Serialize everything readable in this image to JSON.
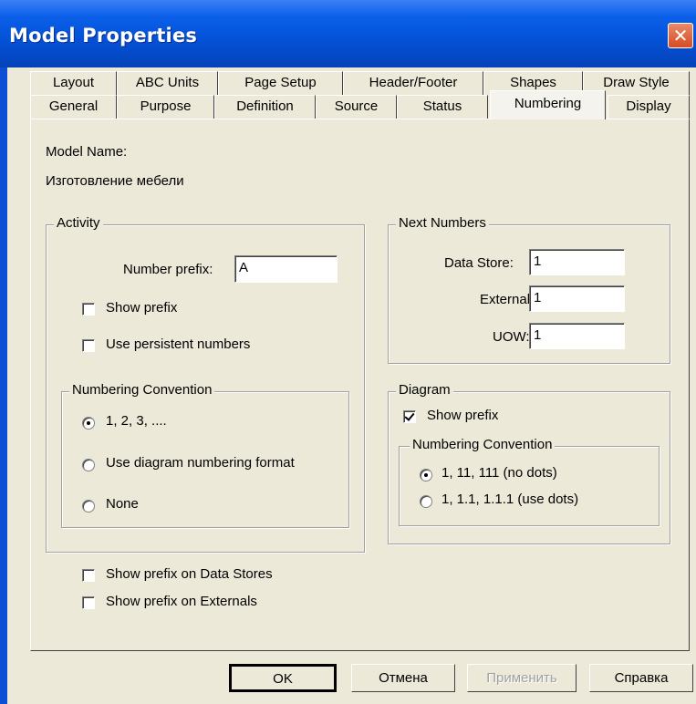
{
  "window": {
    "title": "Model Properties",
    "close_glyph": "✕"
  },
  "tabs": {
    "row1": [
      "Layout",
      "ABC Units",
      "Page Setup",
      "Header/Footer",
      "Shapes",
      "Draw Style"
    ],
    "row2": [
      "General",
      "Purpose",
      "Definition",
      "Source",
      "Status",
      "Numbering",
      "Display"
    ],
    "active": "Numbering"
  },
  "model": {
    "name_label": "Model Name:",
    "name_value": "Изготовление мебели"
  },
  "activity": {
    "legend": "Activity",
    "prefix_label": "Number prefix:",
    "prefix_value": "A",
    "show_prefix_label": "Show prefix",
    "show_prefix_checked": false,
    "persistent_label": "Use persistent numbers",
    "persistent_checked": false,
    "convention": {
      "legend": "Numbering Convention",
      "options": [
        "1, 2, 3, ....",
        "Use diagram numbering format",
        "None"
      ],
      "selected": "1, 2, 3, ...."
    }
  },
  "next_numbers": {
    "legend": "Next Numbers",
    "data_store_label": "Data Store:",
    "data_store_value": "1",
    "external_label": "External:",
    "external_value": "1",
    "uow_label": "UOW:",
    "uow_value": "1"
  },
  "diagram": {
    "legend": "Diagram",
    "show_prefix_label": "Show prefix",
    "show_prefix_checked": true,
    "convention": {
      "legend": "Numbering Convention",
      "options": [
        "1, 11, 111 (no dots)",
        "1, 1.1, 1.1.1 (use dots)"
      ],
      "selected": "1, 11, 111 (no dots)"
    }
  },
  "extras": {
    "data_stores_label": "Show prefix on Data Stores",
    "data_stores_checked": false,
    "externals_label": "Show prefix on Externals",
    "externals_checked": false
  },
  "buttons": {
    "ok": "OK",
    "cancel": "Отмена",
    "apply": "Применить",
    "help": "Справка"
  }
}
